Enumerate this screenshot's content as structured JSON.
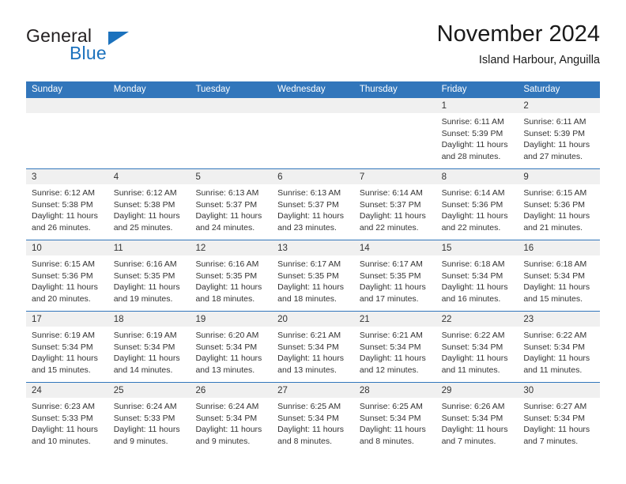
{
  "brand": {
    "name_part1": "General",
    "name_part2": "Blue",
    "logo_icon": "triangle-logo-icon",
    "accent_color": "#1c72bd"
  },
  "header": {
    "title": "November 2024",
    "subtitle": "Island Harbour, Anguilla"
  },
  "calendar": {
    "header_bg_color": "#3276bb",
    "day_band_color": "#f0f0f0",
    "weekdays": [
      "Sunday",
      "Monday",
      "Tuesday",
      "Wednesday",
      "Thursday",
      "Friday",
      "Saturday"
    ],
    "weeks": [
      [
        {
          "day": "",
          "sunrise": "",
          "sunset": "",
          "daylight": ""
        },
        {
          "day": "",
          "sunrise": "",
          "sunset": "",
          "daylight": ""
        },
        {
          "day": "",
          "sunrise": "",
          "sunset": "",
          "daylight": ""
        },
        {
          "day": "",
          "sunrise": "",
          "sunset": "",
          "daylight": ""
        },
        {
          "day": "",
          "sunrise": "",
          "sunset": "",
          "daylight": ""
        },
        {
          "day": "1",
          "sunrise": "Sunrise: 6:11 AM",
          "sunset": "Sunset: 5:39 PM",
          "daylight": "Daylight: 11 hours and 28 minutes."
        },
        {
          "day": "2",
          "sunrise": "Sunrise: 6:11 AM",
          "sunset": "Sunset: 5:39 PM",
          "daylight": "Daylight: 11 hours and 27 minutes."
        }
      ],
      [
        {
          "day": "3",
          "sunrise": "Sunrise: 6:12 AM",
          "sunset": "Sunset: 5:38 PM",
          "daylight": "Daylight: 11 hours and 26 minutes."
        },
        {
          "day": "4",
          "sunrise": "Sunrise: 6:12 AM",
          "sunset": "Sunset: 5:38 PM",
          "daylight": "Daylight: 11 hours and 25 minutes."
        },
        {
          "day": "5",
          "sunrise": "Sunrise: 6:13 AM",
          "sunset": "Sunset: 5:37 PM",
          "daylight": "Daylight: 11 hours and 24 minutes."
        },
        {
          "day": "6",
          "sunrise": "Sunrise: 6:13 AM",
          "sunset": "Sunset: 5:37 PM",
          "daylight": "Daylight: 11 hours and 23 minutes."
        },
        {
          "day": "7",
          "sunrise": "Sunrise: 6:14 AM",
          "sunset": "Sunset: 5:37 PM",
          "daylight": "Daylight: 11 hours and 22 minutes."
        },
        {
          "day": "8",
          "sunrise": "Sunrise: 6:14 AM",
          "sunset": "Sunset: 5:36 PM",
          "daylight": "Daylight: 11 hours and 22 minutes."
        },
        {
          "day": "9",
          "sunrise": "Sunrise: 6:15 AM",
          "sunset": "Sunset: 5:36 PM",
          "daylight": "Daylight: 11 hours and 21 minutes."
        }
      ],
      [
        {
          "day": "10",
          "sunrise": "Sunrise: 6:15 AM",
          "sunset": "Sunset: 5:36 PM",
          "daylight": "Daylight: 11 hours and 20 minutes."
        },
        {
          "day": "11",
          "sunrise": "Sunrise: 6:16 AM",
          "sunset": "Sunset: 5:35 PM",
          "daylight": "Daylight: 11 hours and 19 minutes."
        },
        {
          "day": "12",
          "sunrise": "Sunrise: 6:16 AM",
          "sunset": "Sunset: 5:35 PM",
          "daylight": "Daylight: 11 hours and 18 minutes."
        },
        {
          "day": "13",
          "sunrise": "Sunrise: 6:17 AM",
          "sunset": "Sunset: 5:35 PM",
          "daylight": "Daylight: 11 hours and 18 minutes."
        },
        {
          "day": "14",
          "sunrise": "Sunrise: 6:17 AM",
          "sunset": "Sunset: 5:35 PM",
          "daylight": "Daylight: 11 hours and 17 minutes."
        },
        {
          "day": "15",
          "sunrise": "Sunrise: 6:18 AM",
          "sunset": "Sunset: 5:34 PM",
          "daylight": "Daylight: 11 hours and 16 minutes."
        },
        {
          "day": "16",
          "sunrise": "Sunrise: 6:18 AM",
          "sunset": "Sunset: 5:34 PM",
          "daylight": "Daylight: 11 hours and 15 minutes."
        }
      ],
      [
        {
          "day": "17",
          "sunrise": "Sunrise: 6:19 AM",
          "sunset": "Sunset: 5:34 PM",
          "daylight": "Daylight: 11 hours and 15 minutes."
        },
        {
          "day": "18",
          "sunrise": "Sunrise: 6:19 AM",
          "sunset": "Sunset: 5:34 PM",
          "daylight": "Daylight: 11 hours and 14 minutes."
        },
        {
          "day": "19",
          "sunrise": "Sunrise: 6:20 AM",
          "sunset": "Sunset: 5:34 PM",
          "daylight": "Daylight: 11 hours and 13 minutes."
        },
        {
          "day": "20",
          "sunrise": "Sunrise: 6:21 AM",
          "sunset": "Sunset: 5:34 PM",
          "daylight": "Daylight: 11 hours and 13 minutes."
        },
        {
          "day": "21",
          "sunrise": "Sunrise: 6:21 AM",
          "sunset": "Sunset: 5:34 PM",
          "daylight": "Daylight: 11 hours and 12 minutes."
        },
        {
          "day": "22",
          "sunrise": "Sunrise: 6:22 AM",
          "sunset": "Sunset: 5:34 PM",
          "daylight": "Daylight: 11 hours and 11 minutes."
        },
        {
          "day": "23",
          "sunrise": "Sunrise: 6:22 AM",
          "sunset": "Sunset: 5:34 PM",
          "daylight": "Daylight: 11 hours and 11 minutes."
        }
      ],
      [
        {
          "day": "24",
          "sunrise": "Sunrise: 6:23 AM",
          "sunset": "Sunset: 5:33 PM",
          "daylight": "Daylight: 11 hours and 10 minutes."
        },
        {
          "day": "25",
          "sunrise": "Sunrise: 6:24 AM",
          "sunset": "Sunset: 5:33 PM",
          "daylight": "Daylight: 11 hours and 9 minutes."
        },
        {
          "day": "26",
          "sunrise": "Sunrise: 6:24 AM",
          "sunset": "Sunset: 5:34 PM",
          "daylight": "Daylight: 11 hours and 9 minutes."
        },
        {
          "day": "27",
          "sunrise": "Sunrise: 6:25 AM",
          "sunset": "Sunset: 5:34 PM",
          "daylight": "Daylight: 11 hours and 8 minutes."
        },
        {
          "day": "28",
          "sunrise": "Sunrise: 6:25 AM",
          "sunset": "Sunset: 5:34 PM",
          "daylight": "Daylight: 11 hours and 8 minutes."
        },
        {
          "day": "29",
          "sunrise": "Sunrise: 6:26 AM",
          "sunset": "Sunset: 5:34 PM",
          "daylight": "Daylight: 11 hours and 7 minutes."
        },
        {
          "day": "30",
          "sunrise": "Sunrise: 6:27 AM",
          "sunset": "Sunset: 5:34 PM",
          "daylight": "Daylight: 11 hours and 7 minutes."
        }
      ]
    ]
  }
}
